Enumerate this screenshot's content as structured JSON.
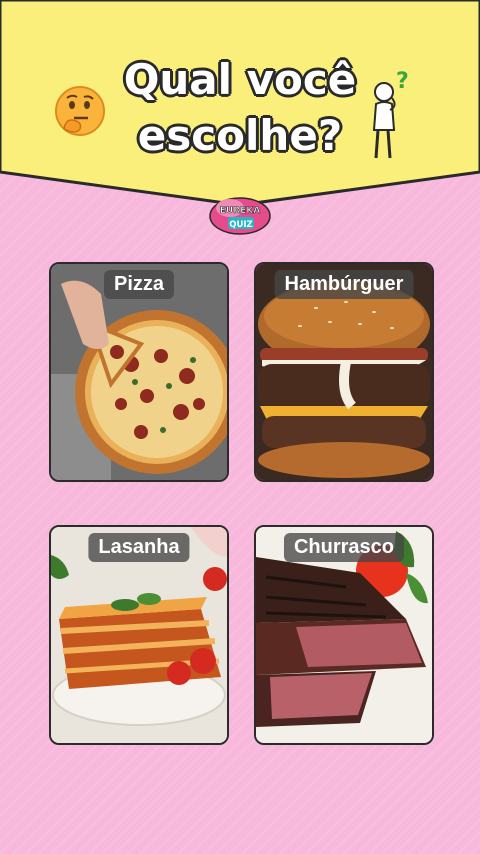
{
  "header": {
    "title_line1": "Qual você",
    "title_line2": "escolhe?",
    "logo_line1": "EUREKA",
    "logo_line2": "QUIZ",
    "question_mark": "?"
  },
  "options": [
    {
      "label": "Pizza"
    },
    {
      "label": "Hambúrguer"
    },
    {
      "label": "Lasanha"
    },
    {
      "label": "Churrasco"
    }
  ],
  "colors": {
    "banner": "#fbef7c",
    "background": "#f7b8dc",
    "card_border": "#2b2b2b",
    "label_bg": "#555555"
  },
  "icons": {
    "thinking_emoji": "thinking-face-icon",
    "thinking_person": "thinking-person-icon"
  }
}
